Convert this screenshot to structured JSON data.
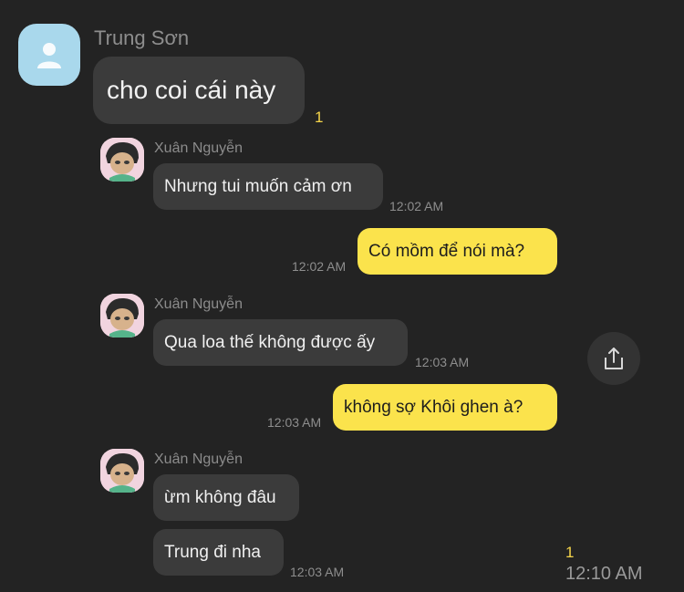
{
  "colors": {
    "background": "#232323",
    "bubble_other": "#3b3b3b",
    "bubble_me": "#fbe34c",
    "unread": "#f5d54b",
    "avatar_main": "#a9d8ec"
  },
  "top_message": {
    "sender": "Trung Sơn",
    "text": "cho coi cái này",
    "unread": "1",
    "avatar_icon": "person-icon"
  },
  "quoted": {
    "group1": {
      "sender": "Xuân Nguyễn",
      "message": "Nhưng tui muốn cảm ơn",
      "time": "12:02 AM"
    },
    "reply1": {
      "message": "Có mồm để nói mà?",
      "time": "12:02 AM"
    },
    "group2": {
      "sender": "Xuân Nguyễn",
      "message": "Qua loa thế không được ấy",
      "time": "12:03 AM"
    },
    "reply2": {
      "message": "không sợ Khôi ghen à?",
      "time": "12:03 AM"
    },
    "group3": {
      "sender": "Xuân Nguyễn",
      "message1": "ừm không đâu",
      "message2": "Trung đi nha",
      "time": "12:03 AM"
    }
  },
  "share": {
    "icon": "share-icon"
  },
  "footer": {
    "unread": "1",
    "time": "12:10 AM"
  }
}
